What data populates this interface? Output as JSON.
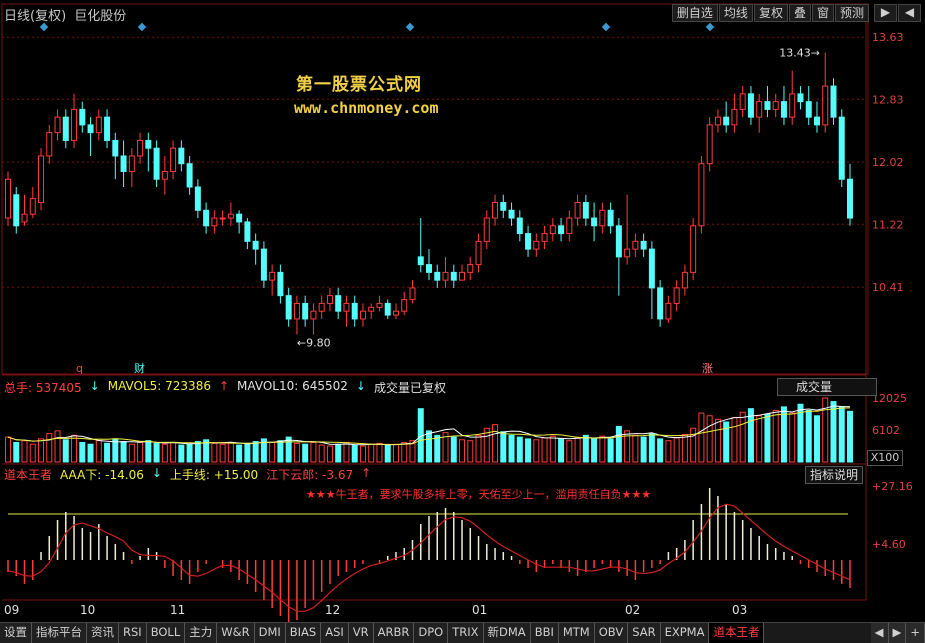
{
  "window": {
    "period": "日线(复权)",
    "stock_name": "巨化股份",
    "toolbar": [
      "删自选",
      "均线",
      "复权",
      "叠",
      "窗",
      "预测"
    ],
    "nav_arrows": [
      "▶",
      "◀"
    ]
  },
  "watermark": {
    "line1": "第一股票公式网",
    "line2": "www.chnmoney.com"
  },
  "price_axis": [
    "13.63",
    "12.83",
    "12.02",
    "11.22",
    "10.41"
  ],
  "price_markers": {
    "high": "13.43",
    "low": "9.80",
    "marker_q": "q",
    "marker_cai": "财",
    "marker_zhang": "涨"
  },
  "volume": {
    "total_label": "总手: 537405",
    "mavol5": "MAVOL5: 723386",
    "mavol10": "MAVOL10: 645502",
    "note": "成交量已复权",
    "dropdown": "成交量",
    "axis": [
      "12025",
      "6102"
    ],
    "unit": "X100"
  },
  "indicator": {
    "name": "道本王者",
    "aaa": "AAA下: -14.06",
    "upper": "上手线: +15.00",
    "lower": "江下云郎: -3.67",
    "help_button": "指标说明",
    "warning": "★★★牛王者，要求牛股多排上零，天佑至少上一，滥用责任自负★★★",
    "axis": [
      "+27.16",
      "+4.60"
    ]
  },
  "dates": [
    "09",
    "10",
    "11",
    "12",
    "01",
    "02",
    "03"
  ],
  "tabs": [
    "设置",
    "指标平台",
    "资讯",
    "RSI",
    "BOLL",
    "主力",
    "W&R",
    "DMI",
    "BIAS",
    "ASI",
    "VR",
    "ARBR",
    "DPO",
    "TRIX",
    "新DMA",
    "BBI",
    "MTM",
    "OBV",
    "SAR",
    "EXPMA",
    "道本王者"
  ],
  "tab_scroll": [
    "◀",
    "▶",
    "+"
  ],
  "colors": {
    "up": "#ff3b3b",
    "down": "#54fcfc",
    "axis_text": "#e04040",
    "grid": "#7a1010",
    "watermark": "#f0d048",
    "yellow_line": "#e8e850"
  },
  "candles": [
    [
      11.3,
      11.8,
      11.9,
      11.2
    ],
    [
      11.6,
      11.2,
      11.7,
      11.1
    ],
    [
      11.25,
      11.35,
      11.6,
      11.2
    ],
    [
      11.35,
      11.55,
      11.7,
      11.3
    ],
    [
      11.5,
      12.1,
      12.2,
      11.4
    ],
    [
      12.1,
      12.4,
      12.5,
      12.0
    ],
    [
      12.4,
      12.6,
      12.7,
      12.3
    ],
    [
      12.6,
      12.3,
      12.7,
      12.2
    ],
    [
      12.3,
      12.7,
      12.9,
      12.2
    ],
    [
      12.7,
      12.5,
      12.8,
      12.4
    ],
    [
      12.5,
      12.4,
      12.6,
      12.1
    ],
    [
      12.4,
      12.6,
      12.7,
      12.3
    ],
    [
      12.6,
      12.3,
      12.7,
      12.2
    ],
    [
      12.3,
      12.1,
      12.4,
      11.8
    ],
    [
      12.1,
      11.9,
      12.3,
      11.7
    ],
    [
      11.9,
      12.1,
      12.2,
      11.7
    ],
    [
      12.1,
      12.3,
      12.4,
      12.0
    ],
    [
      12.3,
      12.2,
      12.4,
      11.9
    ],
    [
      12.2,
      11.8,
      12.3,
      11.7
    ],
    [
      11.8,
      11.9,
      12.1,
      11.6
    ],
    [
      11.9,
      12.2,
      12.3,
      11.8
    ],
    [
      12.2,
      12.0,
      12.3,
      11.9
    ],
    [
      12.0,
      11.7,
      12.1,
      11.6
    ],
    [
      11.7,
      11.4,
      11.8,
      11.3
    ],
    [
      11.4,
      11.2,
      11.5,
      11.1
    ],
    [
      11.2,
      11.3,
      11.4,
      11.1
    ],
    [
      11.3,
      11.3,
      11.4,
      11.2
    ],
    [
      11.3,
      11.35,
      11.5,
      11.2
    ],
    [
      11.35,
      11.25,
      11.4,
      11.1
    ],
    [
      11.25,
      11.0,
      11.3,
      10.9
    ],
    [
      11.0,
      10.9,
      11.1,
      10.7
    ],
    [
      10.9,
      10.5,
      11.0,
      10.4
    ],
    [
      10.5,
      10.6,
      10.7,
      10.3
    ],
    [
      10.6,
      10.3,
      10.7,
      10.2
    ],
    [
      10.3,
      10.0,
      10.4,
      9.9
    ],
    [
      10.0,
      10.2,
      10.3,
      9.8
    ],
    [
      10.2,
      10.0,
      10.3,
      9.9
    ],
    [
      10.0,
      10.1,
      10.2,
      9.8
    ],
    [
      10.1,
      10.2,
      10.3,
      10.0
    ],
    [
      10.2,
      10.3,
      10.4,
      10.1
    ],
    [
      10.3,
      10.1,
      10.4,
      10.0
    ],
    [
      10.1,
      10.2,
      10.3,
      9.9
    ],
    [
      10.2,
      10.0,
      10.3,
      9.9
    ],
    [
      10.0,
      10.1,
      10.2,
      9.9
    ],
    [
      10.1,
      10.15,
      10.2,
      10.0
    ],
    [
      10.15,
      10.2,
      10.3,
      10.1
    ],
    [
      10.2,
      10.05,
      10.25,
      10.0
    ],
    [
      10.05,
      10.1,
      10.2,
      10.0
    ],
    [
      10.1,
      10.25,
      10.35,
      10.05
    ],
    [
      10.25,
      10.4,
      10.5,
      10.2
    ],
    [
      10.8,
      10.7,
      11.3,
      10.6
    ],
    [
      10.7,
      10.6,
      10.9,
      10.5
    ],
    [
      10.6,
      10.5,
      10.7,
      10.4
    ],
    [
      10.5,
      10.6,
      10.8,
      10.4
    ],
    [
      10.6,
      10.5,
      10.7,
      10.4
    ],
    [
      10.5,
      10.6,
      10.7,
      10.5
    ],
    [
      10.6,
      10.7,
      10.8,
      10.5
    ],
    [
      10.7,
      11.0,
      11.1,
      10.6
    ],
    [
      11.0,
      11.3,
      11.4,
      10.9
    ],
    [
      11.3,
      11.5,
      11.6,
      11.2
    ],
    [
      11.5,
      11.4,
      11.6,
      11.3
    ],
    [
      11.4,
      11.3,
      11.5,
      11.2
    ],
    [
      11.3,
      11.1,
      11.4,
      11.0
    ],
    [
      11.1,
      10.9,
      11.2,
      10.8
    ],
    [
      10.9,
      11.0,
      11.1,
      10.8
    ],
    [
      11.0,
      11.1,
      11.2,
      10.9
    ],
    [
      11.1,
      11.2,
      11.3,
      11.0
    ],
    [
      11.2,
      11.1,
      11.3,
      11.0
    ],
    [
      11.1,
      11.3,
      11.4,
      11.0
    ],
    [
      11.3,
      11.5,
      11.6,
      11.2
    ],
    [
      11.5,
      11.3,
      11.6,
      11.2
    ],
    [
      11.3,
      11.2,
      11.5,
      11.0
    ],
    [
      11.2,
      11.4,
      11.5,
      11.1
    ],
    [
      11.4,
      11.2,
      11.5,
      11.1
    ],
    [
      11.2,
      10.8,
      11.3,
      10.3
    ],
    [
      10.8,
      10.9,
      11.6,
      10.7
    ],
    [
      10.9,
      11.0,
      11.1,
      10.8
    ],
    [
      11.0,
      10.9,
      11.1,
      10.8
    ],
    [
      10.9,
      10.4,
      11.0,
      10.0
    ],
    [
      10.4,
      10.0,
      10.5,
      9.9
    ],
    [
      10.0,
      10.2,
      10.3,
      9.95
    ],
    [
      10.2,
      10.4,
      10.5,
      10.1
    ],
    [
      10.4,
      10.6,
      10.7,
      10.3
    ],
    [
      10.6,
      11.2,
      11.3,
      10.5
    ],
    [
      11.2,
      12.0,
      12.1,
      11.1
    ],
    [
      12.0,
      12.5,
      12.6,
      11.9
    ],
    [
      12.5,
      12.6,
      12.7,
      12.4
    ],
    [
      12.6,
      12.5,
      12.8,
      12.4
    ],
    [
      12.5,
      12.7,
      12.9,
      12.4
    ],
    [
      12.7,
      12.9,
      13.0,
      12.6
    ],
    [
      12.9,
      12.6,
      13.0,
      12.5
    ],
    [
      12.6,
      12.8,
      12.9,
      12.4
    ],
    [
      12.8,
      12.7,
      13.0,
      12.6
    ],
    [
      12.7,
      12.8,
      12.9,
      12.6
    ],
    [
      12.8,
      12.6,
      13.0,
      12.5
    ],
    [
      12.6,
      12.9,
      13.2,
      12.5
    ],
    [
      12.9,
      12.8,
      13.0,
      12.7
    ],
    [
      12.8,
      12.6,
      13.0,
      12.5
    ],
    [
      12.6,
      12.5,
      12.8,
      12.4
    ],
    [
      12.5,
      13.0,
      13.43,
      12.4
    ],
    [
      13.0,
      12.6,
      13.1,
      12.5
    ],
    [
      12.6,
      11.8,
      12.7,
      11.7
    ],
    [
      11.8,
      11.3,
      12.0,
      11.2
    ]
  ],
  "volumes": [
    28,
    22,
    24,
    20,
    26,
    32,
    35,
    25,
    30,
    22,
    20,
    24,
    21,
    26,
    23,
    20,
    22,
    24,
    21,
    20,
    22,
    19,
    20,
    23,
    25,
    21,
    20,
    22,
    19,
    21,
    23,
    26,
    22,
    24,
    28,
    21,
    20,
    22,
    19,
    18,
    20,
    22,
    19,
    18,
    20,
    21,
    19,
    20,
    22,
    24,
    60,
    35,
    30,
    33,
    28,
    25,
    24,
    30,
    38,
    42,
    34,
    30,
    28,
    26,
    25,
    27,
    29,
    26,
    24,
    28,
    30,
    27,
    29,
    26,
    40,
    35,
    30,
    28,
    32,
    26,
    24,
    27,
    31,
    38,
    55,
    52,
    48,
    45,
    50,
    56,
    60,
    52,
    54,
    58,
    62,
    55,
    65,
    58,
    52,
    72,
    68,
    62,
    57
  ],
  "ind_bars": [
    -3,
    -4,
    -6,
    -5,
    2,
    6,
    10,
    12,
    11,
    8,
    7,
    9,
    6,
    4,
    2,
    -1,
    1,
    3,
    2,
    -2,
    -4,
    -5,
    -6,
    -3,
    -1,
    0,
    -2,
    -3,
    -5,
    -6,
    -8,
    -10,
    -12,
    -14,
    -16,
    -15,
    -12,
    -10,
    -8,
    -6,
    -4,
    -3,
    -2,
    -1,
    0,
    -1,
    1,
    2,
    3,
    5,
    9,
    11,
    12,
    13,
    12,
    10,
    8,
    6,
    4,
    3,
    2,
    1,
    -1,
    -2,
    -3,
    -2,
    -1,
    -2,
    -3,
    -4,
    -3,
    -2,
    -1,
    -2,
    -3,
    -4,
    -5,
    -3,
    -2,
    -1,
    2,
    3,
    5,
    10,
    14,
    18,
    16,
    14,
    12,
    10,
    8,
    6,
    4,
    3,
    2,
    1,
    -1,
    -2,
    -3,
    -4,
    -5,
    -6,
    -7
  ]
}
